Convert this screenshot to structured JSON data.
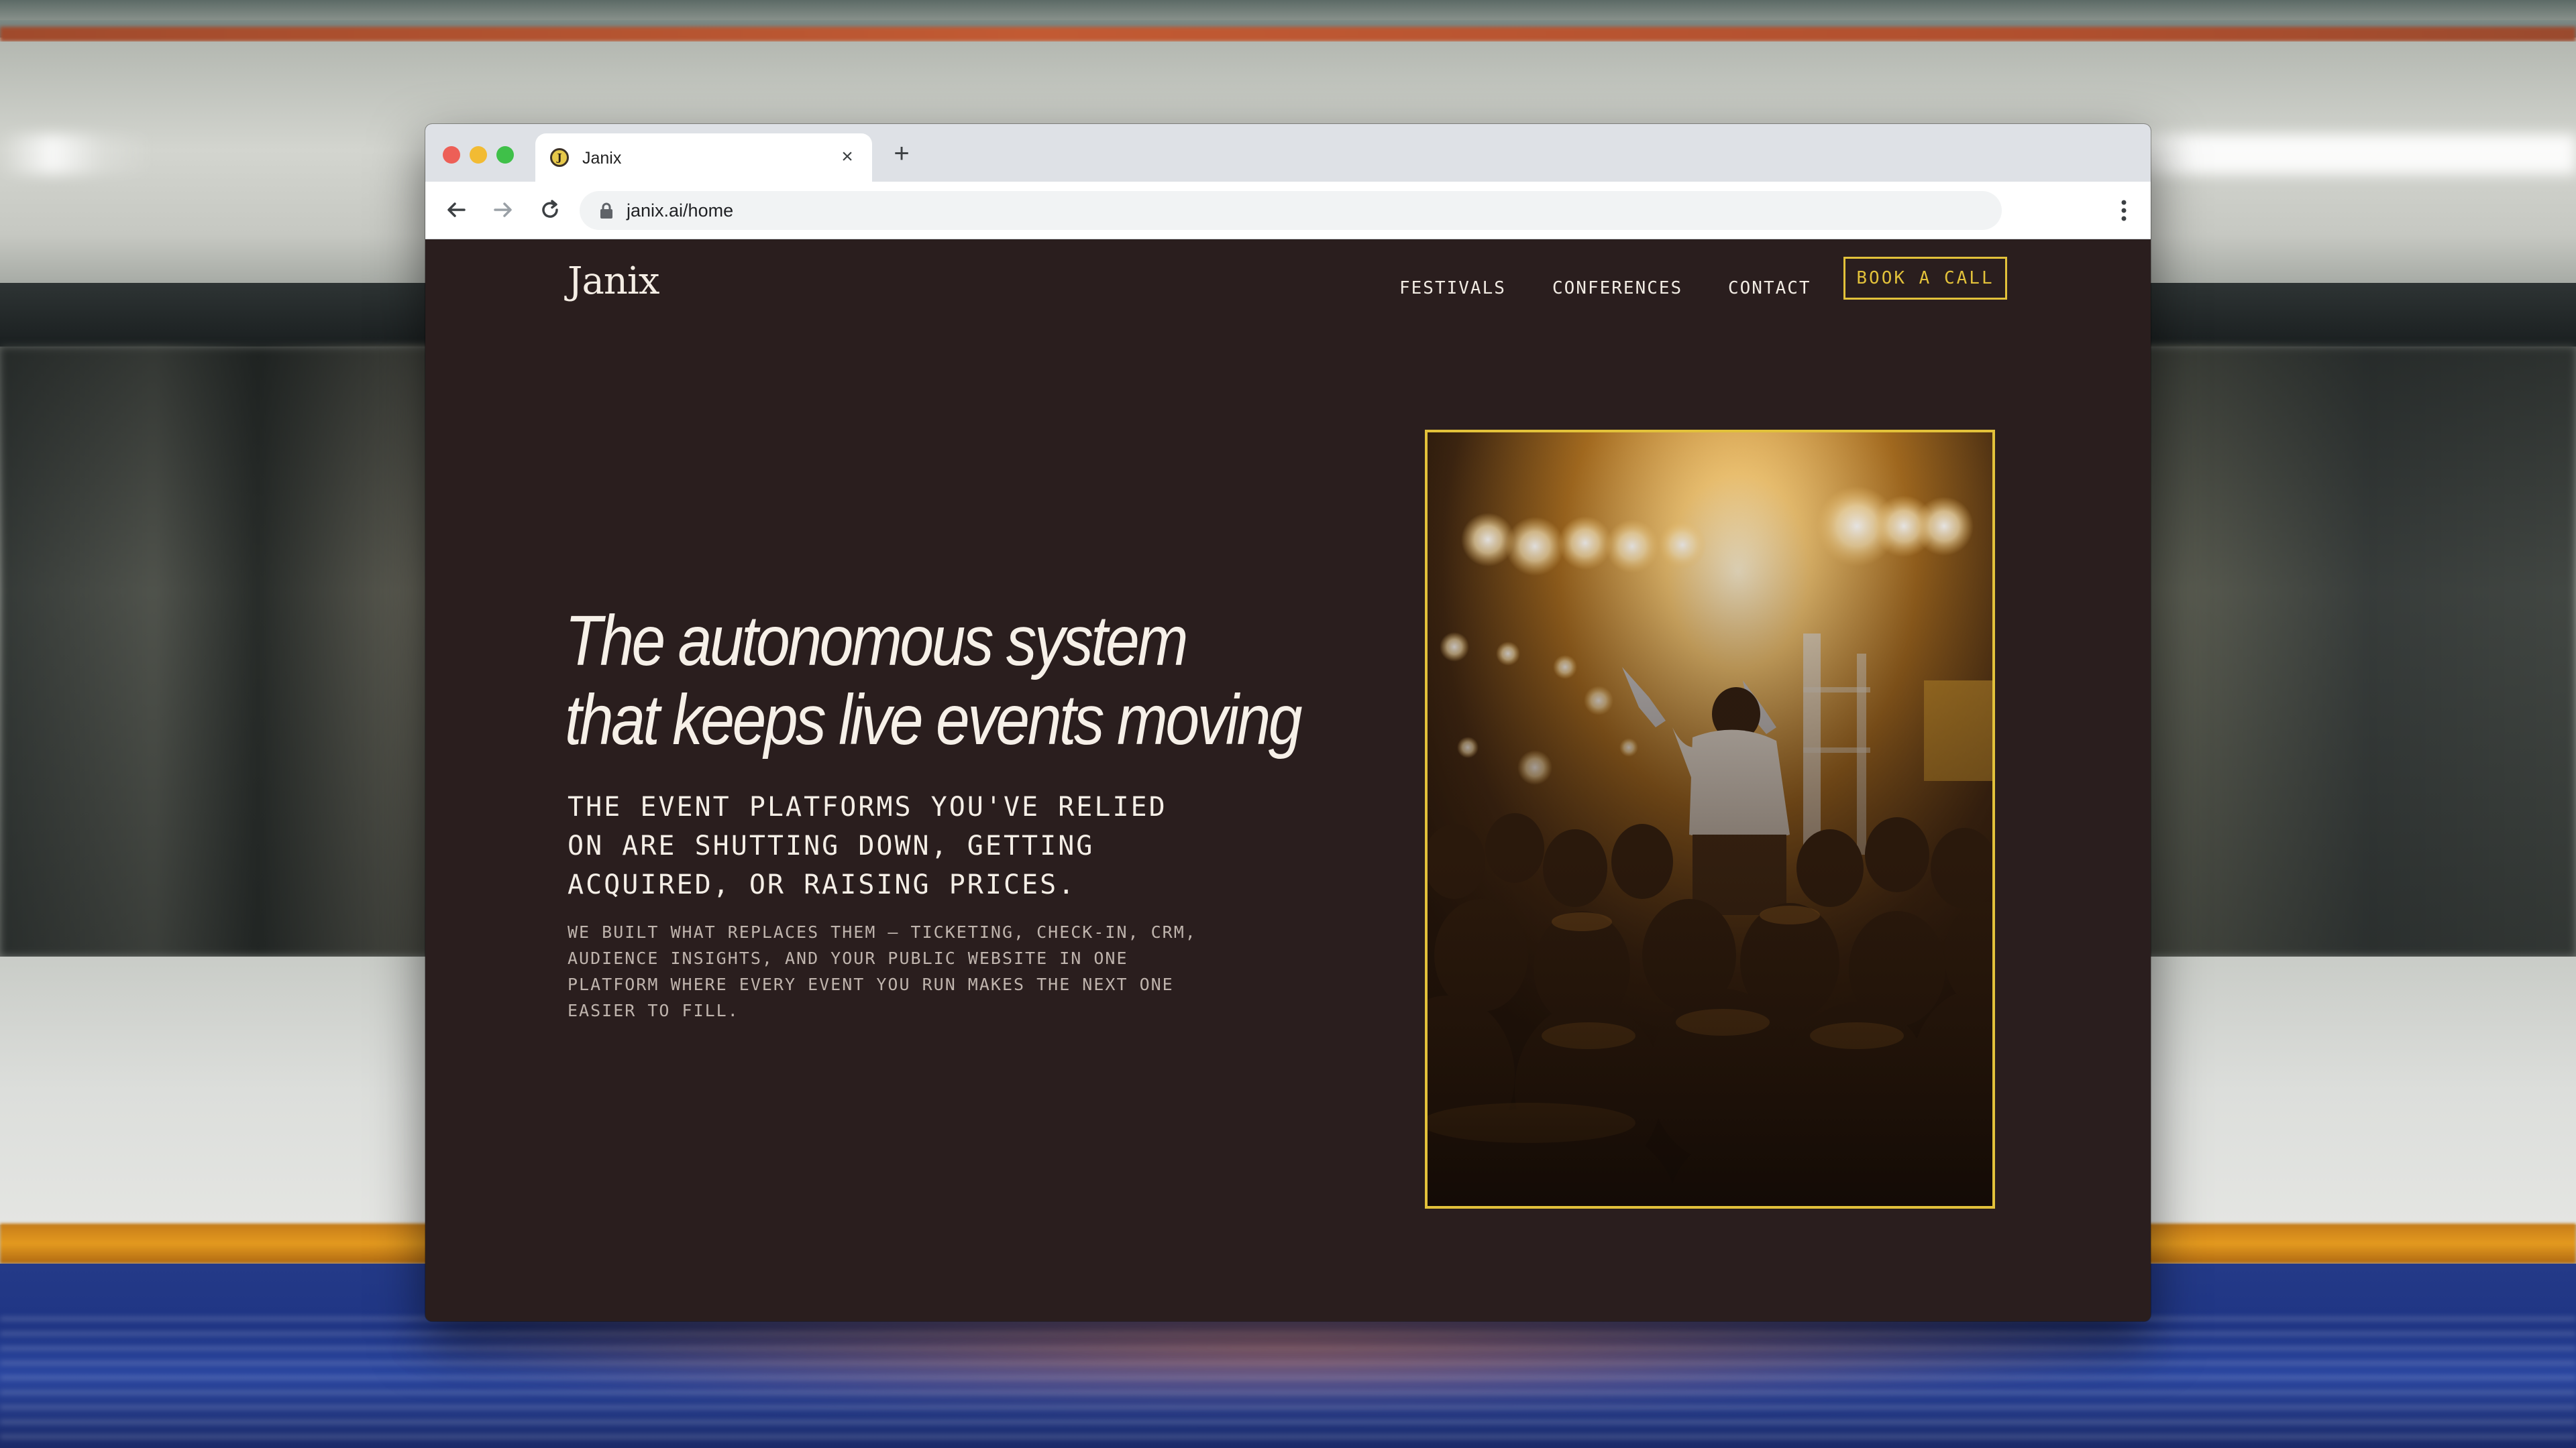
{
  "browser": {
    "tab_title": "Janix",
    "favicon_letter": "J",
    "url": "janix.ai/home"
  },
  "site": {
    "logo": "Janix",
    "nav": {
      "festivals": "FESTIVALS",
      "conferences": "CONFERENCES",
      "contact": "CONTACT",
      "cta": "BOOK A CALL"
    },
    "hero": {
      "title_line1": "The autonomous system",
      "title_line2": "that keeps live events moving",
      "subhead": "THE EVENT PLATFORMS YOU'VE RELIED ON ARE SHUTTING DOWN, GETTING ACQUIRED, OR RAISING PRICES.",
      "body": "WE BUILT WHAT REPLACES THEM — TICKETING, CHECK-IN, CRM, AUDIENCE INSIGHTS, AND YOUR PUBLIC WEBSITE IN ONE PLATFORM WHERE EVERY EVENT YOU RUN MAKES THE NEXT ONE EASIER TO FILL."
    }
  },
  "colors": {
    "page_bg": "#2a1e1e",
    "accent": "#e2c13a",
    "text": "#f4eee6",
    "muted_text": "#bfb4ad"
  },
  "icons": {
    "back": "arrow-left-icon",
    "forward": "arrow-right-icon",
    "reload": "reload-icon",
    "lock": "lock-icon",
    "menu": "kebab-menu-icon",
    "close": "close-icon",
    "new_tab": "plus-icon"
  }
}
